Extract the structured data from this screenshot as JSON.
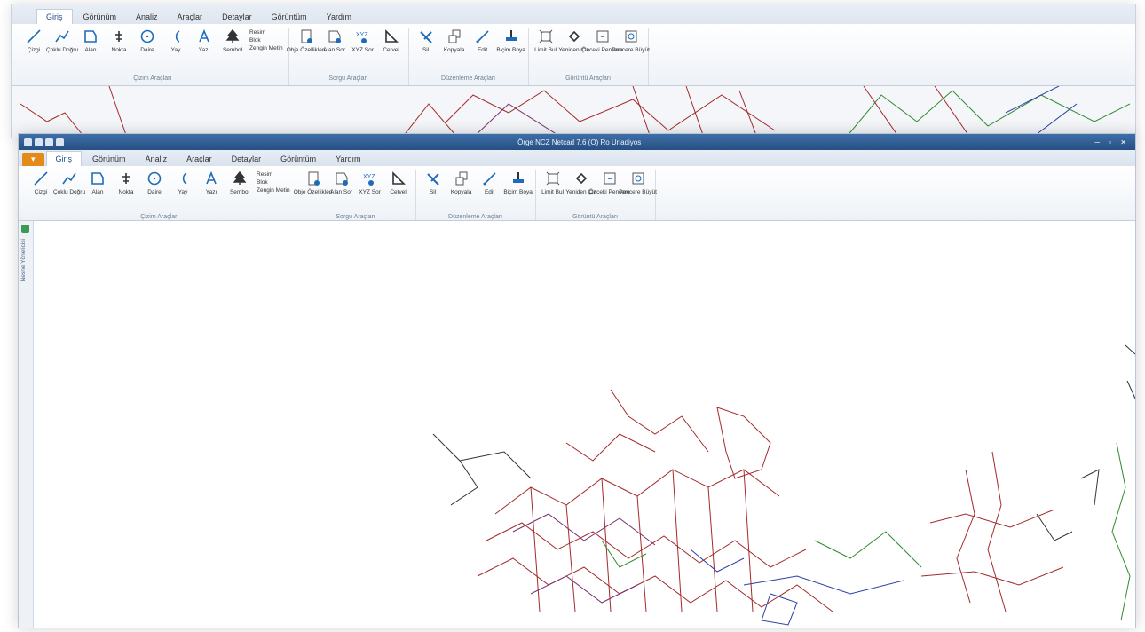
{
  "bg_window": {
    "tabs": [
      {
        "label": "Giriş",
        "active": true
      },
      {
        "label": "Görünüm",
        "active": false
      },
      {
        "label": "Analiz",
        "active": false
      },
      {
        "label": "Araçlar",
        "active": false
      },
      {
        "label": "Detaylar",
        "active": false
      },
      {
        "label": "Görüntüm",
        "active": false
      },
      {
        "label": "Yardım",
        "active": false
      }
    ],
    "groups": [
      {
        "label": "Çizim Araçları",
        "tools": [
          "Çizgi",
          "Çoklu Doğru",
          "Alan",
          "Nokta",
          "Daire",
          "Yay",
          "Yazı",
          "Sembol"
        ],
        "small": [
          "Resim",
          "Blok",
          "Zengin Metin"
        ]
      },
      {
        "label": "Sorgu Araçları",
        "tools": [
          "Obje Özellikleri",
          "Alan Sor",
          "XYZ Sor",
          "Cetvel"
        ]
      },
      {
        "label": "Düzenleme Araçları",
        "tools": [
          "Sil",
          "Kopyala",
          "Edit",
          "Biçim Boya"
        ]
      },
      {
        "label": "Görüntü Araçları",
        "tools": [
          "Limit Bul",
          "Yeniden Çiz",
          "Önceki Pencere",
          "Pencere Büyüt"
        ]
      }
    ]
  },
  "fg_window": {
    "title": "Örge NCZ Netcad 7.6 (O) Ro Uriadiyos",
    "app_button": "▾",
    "tabs": [
      {
        "label": "Giriş",
        "active": true
      },
      {
        "label": "Görünüm",
        "active": false
      },
      {
        "label": "Analiz",
        "active": false
      },
      {
        "label": "Araçlar",
        "active": false
      },
      {
        "label": "Detaylar",
        "active": false
      },
      {
        "label": "Görüntüm",
        "active": false
      },
      {
        "label": "Yardım",
        "active": false
      }
    ],
    "groups": [
      {
        "label": "Çizim Araçları",
        "tools": [
          "Çizgi",
          "Çoklu Doğru",
          "Alan",
          "Nokta",
          "Daire",
          "Yay",
          "Yazı",
          "Sembol"
        ],
        "small": [
          "Resim",
          "Blok",
          "Zengin Metin"
        ]
      },
      {
        "label": "Sorgu Araçları",
        "tools": [
          "Obje Özellikleri",
          "Alan Sor",
          "XYZ Sor",
          "Cetvel"
        ]
      },
      {
        "label": "Düzenleme Araçları",
        "tools": [
          "Sil",
          "Kopyala",
          "Edit",
          "Biçim Boya"
        ]
      },
      {
        "label": "Görüntü Araçları",
        "tools": [
          "Limit Bul",
          "Yeniden Çiz",
          "Önceki Pencere",
          "Pencere Büyüt"
        ]
      }
    ],
    "side_panel_label": "Nesne Yöneticisi"
  },
  "colors": {
    "ribbon_blue": "#1e6bb8",
    "title_blue": "#2f5f98",
    "app_orange": "#e38a19",
    "map_red": "#a52a2a",
    "map_green": "#2e8b2e",
    "map_purple": "#7a2f6f",
    "map_blue": "#2a3fa5"
  }
}
